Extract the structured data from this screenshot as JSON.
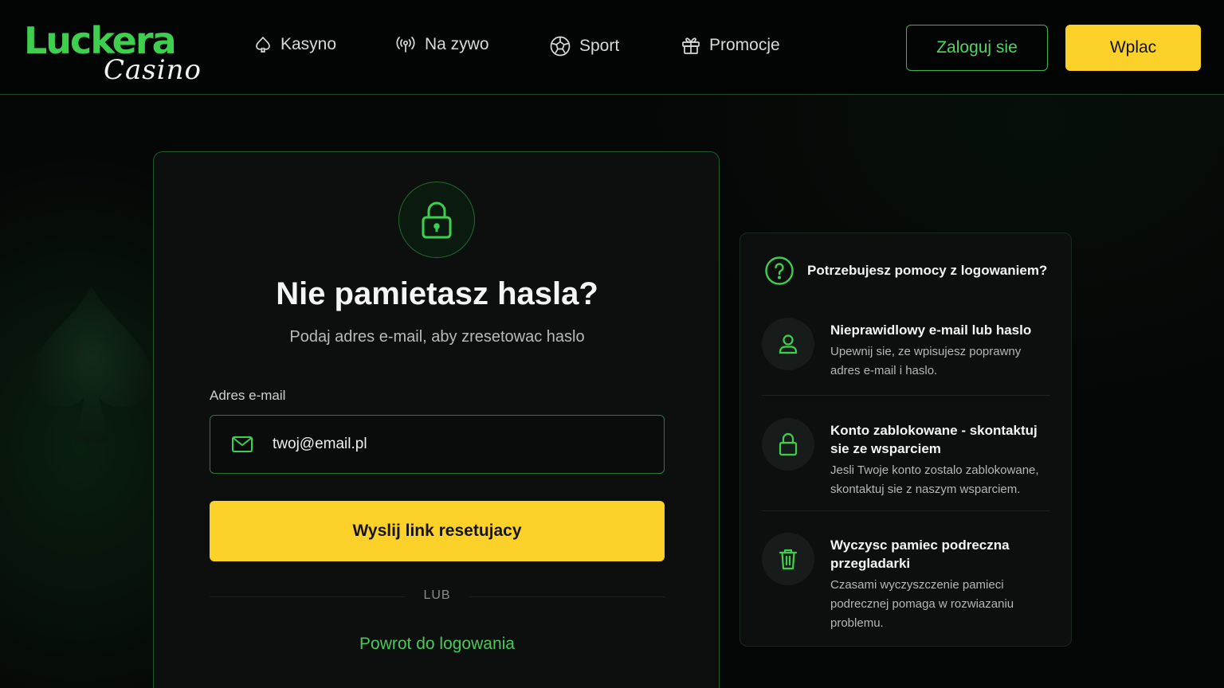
{
  "brand": {
    "name": "Luckera",
    "sub": "Casino"
  },
  "nav": [
    {
      "label": "Kasyno",
      "icon": "spade-icon"
    },
    {
      "label": "Na zywo",
      "icon": "broadcast-icon"
    },
    {
      "label": "Sport",
      "icon": "soccer-ball-icon"
    },
    {
      "label": "Promocje",
      "icon": "gift-icon"
    }
  ],
  "header_actions": {
    "login": "Zaloguj sie",
    "deposit": "Wplac"
  },
  "reset_card": {
    "title": "Nie pamietasz hasla?",
    "subtitle": "Podaj adres e-mail, aby zresetowac haslo",
    "email_label": "Adres e-mail",
    "email_value": "twoj@email.pl",
    "submit": "Wyslij link resetujacy",
    "or": "LUB",
    "back": "Powrot do logowania"
  },
  "help": {
    "title": "Potrzebujesz pomocy z logowaniem?",
    "items": [
      {
        "title": "Nieprawidlowy e-mail lub haslo",
        "desc": "Upewnij sie, ze wpisujesz poprawny adres e-mail i haslo.",
        "icon": "user-icon"
      },
      {
        "title": "Konto zablokowane - skontaktuj sie ze wsparciem",
        "desc": "Jesli Twoje konto zostalo zablokowane, skontaktuj sie z naszym wsparciem.",
        "icon": "lock-icon"
      },
      {
        "title": "Wyczysc pamiec podreczna przegladarki",
        "desc": "Czasami wyczyszczenie pamieci podrecznej pomaga w rozwiazaniu problemu.",
        "icon": "trash-icon"
      }
    ]
  },
  "colors": {
    "accent_green": "#3fcf4f",
    "accent_yellow": "#fcd12a",
    "background": "#050706"
  }
}
